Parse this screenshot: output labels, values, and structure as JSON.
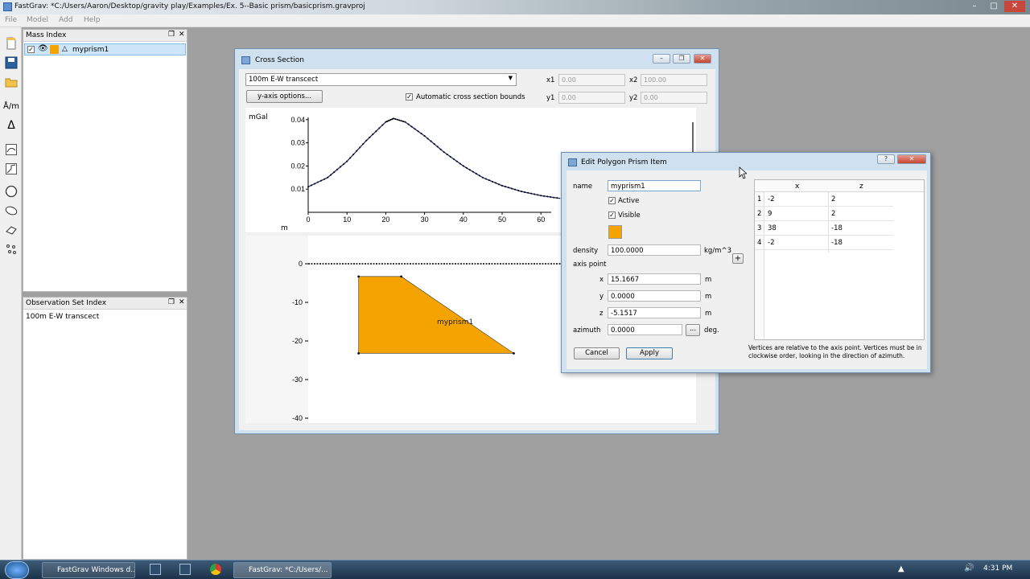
{
  "app": {
    "title": "FastGrav: *C:/Users/Aaron/Desktop/gravity play/Examples/Ex. 5--Basic prism/basicprism.gravproj",
    "menu": [
      "File",
      "Model",
      "Add",
      "Help"
    ]
  },
  "mass_index": {
    "title": "Mass Index",
    "item": "myprism1"
  },
  "obs_index": {
    "title": "Observation Set Index",
    "item": "100m E-W transcect"
  },
  "cross_section": {
    "title": "Cross Section",
    "transect": "100m E-W transcect",
    "yaxis_btn": "y-axis options...",
    "auto_bounds": "Automatic cross section bounds",
    "x1_label": "x1",
    "x1": "0.00",
    "x2_label": "x2",
    "x2": "100.00",
    "y1_label": "y1",
    "y1": "0.00",
    "y2_label": "y2",
    "y2": "0.00",
    "prism_label": "myprism1"
  },
  "chart_data": [
    {
      "type": "line",
      "ylabel": "mGal",
      "xlabel": "m",
      "xlim": [
        0,
        100
      ],
      "ylim": [
        0,
        0.045
      ],
      "x_ticks": [
        "0",
        "10",
        "20",
        "30",
        "40",
        "50",
        "60"
      ],
      "y_ticks": [
        "0.01",
        "0.02",
        "0.03",
        "0.04"
      ],
      "series": [
        {
          "values_x": [
            0,
            5,
            10,
            15,
            20,
            22,
            25,
            30,
            35,
            40,
            45,
            50,
            55,
            60,
            65
          ],
          "values_y": [
            0.011,
            0.015,
            0.022,
            0.031,
            0.039,
            0.0405,
            0.039,
            0.033,
            0.026,
            0.02,
            0.015,
            0.0115,
            0.009,
            0.0072,
            0.006
          ]
        }
      ]
    },
    {
      "type": "area",
      "xlim": [
        0,
        100
      ],
      "ylim": [
        -40,
        2
      ],
      "y_ticks": [
        "0",
        "-10",
        "-20",
        "-30",
        "-40"
      ],
      "polygon": [
        [
          13,
          -3.3
        ],
        [
          24,
          -3.3
        ],
        [
          53,
          -23.2
        ],
        [
          13,
          -23.2
        ]
      ],
      "fill": "#f4a300"
    }
  ],
  "dialog": {
    "title": "Edit Polygon Prism Item",
    "name_label": "name",
    "name": "myprism1",
    "active": "Active",
    "visible": "Visible",
    "density_label": "density",
    "density": "100.0000",
    "density_unit": "kg/m^3",
    "axis_point": "axis point",
    "x_label": "x",
    "x": "15.1667",
    "y_label": "y",
    "y": "0.0000",
    "z_label": "z",
    "z": "-5.1517",
    "m": "m",
    "azimuth_label": "azimuth",
    "azimuth": "0.0000",
    "dots": "...",
    "deg": "deg.",
    "cancel": "Cancel",
    "apply": "Apply",
    "plus": "+",
    "col_x": "x",
    "col_z": "z",
    "rows": [
      {
        "n": "1",
        "x": "-2",
        "z": "2"
      },
      {
        "n": "2",
        "x": "9",
        "z": "2"
      },
      {
        "n": "3",
        "x": "38",
        "z": "-18"
      },
      {
        "n": "4",
        "x": "-2",
        "z": "-18"
      }
    ],
    "note": "Vertices are relative to the axis point. Vertices must be in clockwise order, looking in the direction of azimuth."
  },
  "taskbar": {
    "task1": "FastGrav Windows d...",
    "task2": "FastGrav: *C:/Users/...",
    "time": "4:31 PM"
  },
  "colors": {
    "accent": "#f4a300",
    "window_frame": "#cfe0ef"
  }
}
